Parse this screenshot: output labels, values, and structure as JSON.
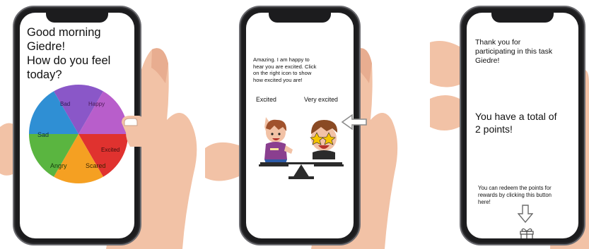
{
  "screen1": {
    "greeting_line1": "Good morning",
    "greeting_line2": "Giedre!",
    "greeting_line3": "How do you feel",
    "greeting_line4": "today?",
    "wheel": {
      "segments": [
        {
          "label": "Bad",
          "color": "#8a57c8"
        },
        {
          "label": "Happy",
          "color": "#b85ecb"
        },
        {
          "label": "Excited",
          "color": "#e0322f"
        },
        {
          "label": "Scared",
          "color": "#f5a022"
        },
        {
          "label": "Angry",
          "color": "#5ab540"
        },
        {
          "label": "Sad",
          "color": "#2f8fd4"
        }
      ]
    }
  },
  "screen2": {
    "message_line1": "Amazing. I am happy to",
    "message_line2": "hear you are excited. Click",
    "message_line3": "on the right icon to show",
    "message_line4": "how excited you are!",
    "label_left": "Excited",
    "label_right": "Very excited"
  },
  "screen3": {
    "thanks_line1": "Thank you for",
    "thanks_line2": "participating in this task",
    "thanks_line3": "Giedre!",
    "points_line1": "You have a total of",
    "points_line2": "2 points!",
    "redeem_line1": "You can redeem the points for",
    "redeem_line2": "rewards by clicking this button",
    "redeem_line3": "here!"
  },
  "colors": {
    "phone_frame": "#1c1c1e",
    "skin": "#f2c2a6",
    "text": "#111111"
  }
}
